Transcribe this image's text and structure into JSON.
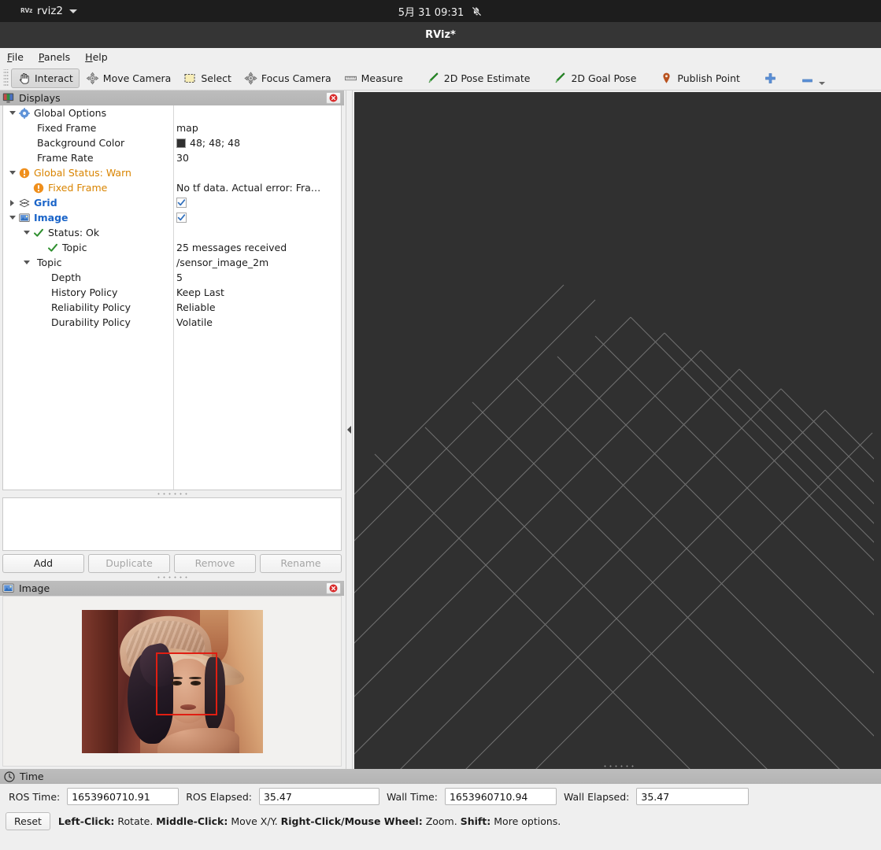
{
  "system_bar": {
    "logo_text": "RVz",
    "app_name": "rviz2",
    "clock": "5月 31  09:31",
    "notification_icon": "bell-muted-icon"
  },
  "window": {
    "title": "RViz*"
  },
  "menubar": {
    "items": [
      {
        "label": "File",
        "mnemonic": "F"
      },
      {
        "label": "Panels",
        "mnemonic": "P"
      },
      {
        "label": "Help",
        "mnemonic": "H"
      }
    ]
  },
  "toolbar": {
    "buttons": [
      {
        "label": "Interact",
        "icon": "hand-cursor-icon",
        "checked": true
      },
      {
        "label": "Move Camera",
        "icon": "move-camera-icon",
        "checked": false
      },
      {
        "label": "Select",
        "icon": "selection-rect-icon",
        "checked": false
      },
      {
        "label": "Focus Camera",
        "icon": "focus-camera-icon",
        "checked": false
      },
      {
        "label": "Measure",
        "icon": "ruler-icon",
        "checked": false
      },
      {
        "label": "2D Pose Estimate",
        "icon": "green-arrow-icon",
        "checked": false
      },
      {
        "label": "2D Goal Pose",
        "icon": "green-arrow-icon",
        "checked": false
      },
      {
        "label": "Publish Point",
        "icon": "map-pin-icon",
        "checked": false
      }
    ],
    "plus_icon": "plus-icon",
    "minus_icon": "minus-icon",
    "overflow_icon": "chevron-down-icon",
    "accent_blue": "#4b87d4",
    "accent_green": "#3faf3f",
    "accent_pin": "#b9521f"
  },
  "displays_panel": {
    "title": "Displays",
    "title_icon": "display-monitor-icon",
    "close_icon": "close-icon",
    "tree": [
      {
        "indent": 0,
        "arrow": "open",
        "icon": "gear-icon",
        "label": "Global Options",
        "style": "normal",
        "value": ""
      },
      {
        "indent": 1,
        "arrow": "none",
        "icon": "none",
        "label": "Fixed Frame",
        "style": "normal",
        "value": "map"
      },
      {
        "indent": 1,
        "arrow": "none",
        "icon": "none",
        "label": "Background Color",
        "style": "normal",
        "value": "48; 48; 48",
        "value_type": "color",
        "color": "#303030"
      },
      {
        "indent": 1,
        "arrow": "none",
        "icon": "none",
        "label": "Frame Rate",
        "style": "normal",
        "value": "30"
      },
      {
        "indent": 0,
        "arrow": "open",
        "icon": "warning-icon",
        "label": "Global Status: Warn",
        "style": "warn",
        "value": ""
      },
      {
        "indent": 1,
        "arrow": "none",
        "icon": "warning-icon",
        "label": "Fixed Frame",
        "style": "warn",
        "value": "No tf data.  Actual error: Fra…"
      },
      {
        "indent": 0,
        "arrow": "closed",
        "icon": "grid-icon",
        "label": "Grid",
        "style": "blue",
        "value": "",
        "value_type": "checkbox",
        "checked": true
      },
      {
        "indent": 0,
        "arrow": "open",
        "icon": "image-icon",
        "label": "Image",
        "style": "blue",
        "value": "",
        "value_type": "checkbox",
        "checked": true
      },
      {
        "indent": 1,
        "arrow": "open",
        "icon": "check-icon",
        "label": "Status: Ok",
        "style": "normal",
        "value": ""
      },
      {
        "indent": 2,
        "arrow": "none",
        "icon": "check-icon",
        "label": "Topic",
        "style": "normal",
        "value": "25 messages received"
      },
      {
        "indent": 1,
        "arrow": "open",
        "icon": "none",
        "label": "Topic",
        "style": "normal",
        "value": "/sensor_image_2m"
      },
      {
        "indent": 2,
        "arrow": "none",
        "icon": "none",
        "label": "Depth",
        "style": "normal",
        "value": "5"
      },
      {
        "indent": 2,
        "arrow": "none",
        "icon": "none",
        "label": "History Policy",
        "style": "normal",
        "value": "Keep Last"
      },
      {
        "indent": 2,
        "arrow": "none",
        "icon": "none",
        "label": "Reliability Policy",
        "style": "normal",
        "value": "Reliable"
      },
      {
        "indent": 2,
        "arrow": "none",
        "icon": "none",
        "label": "Durability Policy",
        "style": "normal",
        "value": "Volatile"
      }
    ],
    "buttons": [
      {
        "label": "Add",
        "enabled": true
      },
      {
        "label": "Duplicate",
        "enabled": false
      },
      {
        "label": "Remove",
        "enabled": false
      },
      {
        "label": "Rename",
        "enabled": false
      }
    ]
  },
  "image_panel": {
    "title": "Image",
    "title_icon": "image-icon",
    "close_icon": "close-icon",
    "content_description": "lenna-test-image-with-red-face-bounding-box",
    "bbox_color": "#e01e12"
  },
  "render_view": {
    "background_color": "#303030",
    "grid_color": "#9a9a9a"
  },
  "time_panel": {
    "title": "Time",
    "title_icon": "clock-icon",
    "fields": [
      {
        "label": "ROS Time:",
        "value": "1653960710.91"
      },
      {
        "label": "ROS Elapsed:",
        "value": "35.47"
      },
      {
        "label": "Wall Time:",
        "value": "1653960710.94"
      },
      {
        "label": "Wall Elapsed:",
        "value": "35.47"
      }
    ]
  },
  "status_bar": {
    "reset_label": "Reset",
    "hints": [
      {
        "key": "Left-Click:",
        "text": " Rotate. "
      },
      {
        "key": "Middle-Click:",
        "text": " Move X/Y. "
      },
      {
        "key": "Right-Click/Mouse Wheel:",
        "text": " Zoom. "
      },
      {
        "key": "Shift:",
        "text": " More options."
      }
    ]
  }
}
